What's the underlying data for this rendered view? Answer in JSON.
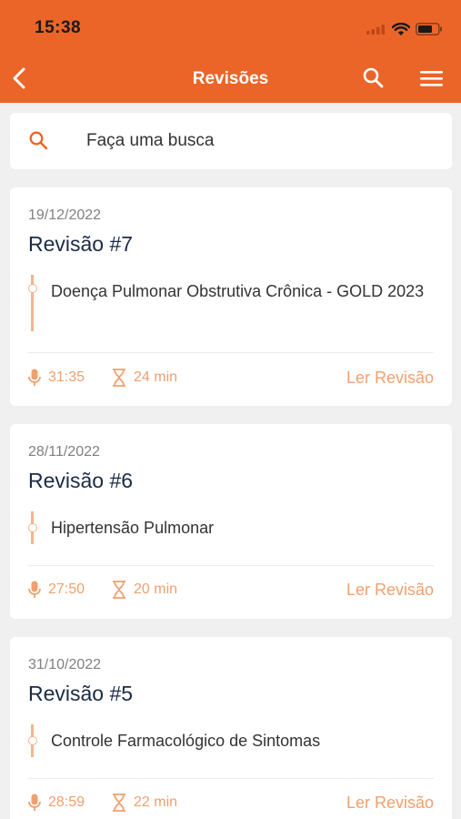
{
  "status_bar": {
    "time": "15:38"
  },
  "nav": {
    "title": "Revisões"
  },
  "search": {
    "placeholder": "Faça uma busca"
  },
  "reviews": [
    {
      "date": "19/12/2022",
      "title": "Revisão #7",
      "topic": "Doença Pulmonar Obstrutiva Crônica - GOLD 2023",
      "audio_duration": "31:35",
      "reading_time": "24 min",
      "action": "Ler Revisão"
    },
    {
      "date": "28/11/2022",
      "title": "Revisão #6",
      "topic": "Hipertensão Pulmonar",
      "audio_duration": "27:50",
      "reading_time": "20 min",
      "action": "Ler Revisão"
    },
    {
      "date": "31/10/2022",
      "title": "Revisão #5",
      "topic": "Controle Farmacológico de Sintomas",
      "audio_duration": "28:59",
      "reading_time": "22 min",
      "action": "Ler Revisão"
    }
  ],
  "colors": {
    "brand": "#eb6528",
    "accent_light": "#f0a06e",
    "title_text": "#1c2b45"
  },
  "icons": {
    "back": "chevron-left-icon",
    "search": "search-icon",
    "menu": "hamburger-menu-icon",
    "audio": "microphone-icon",
    "time": "hourglass-icon"
  }
}
